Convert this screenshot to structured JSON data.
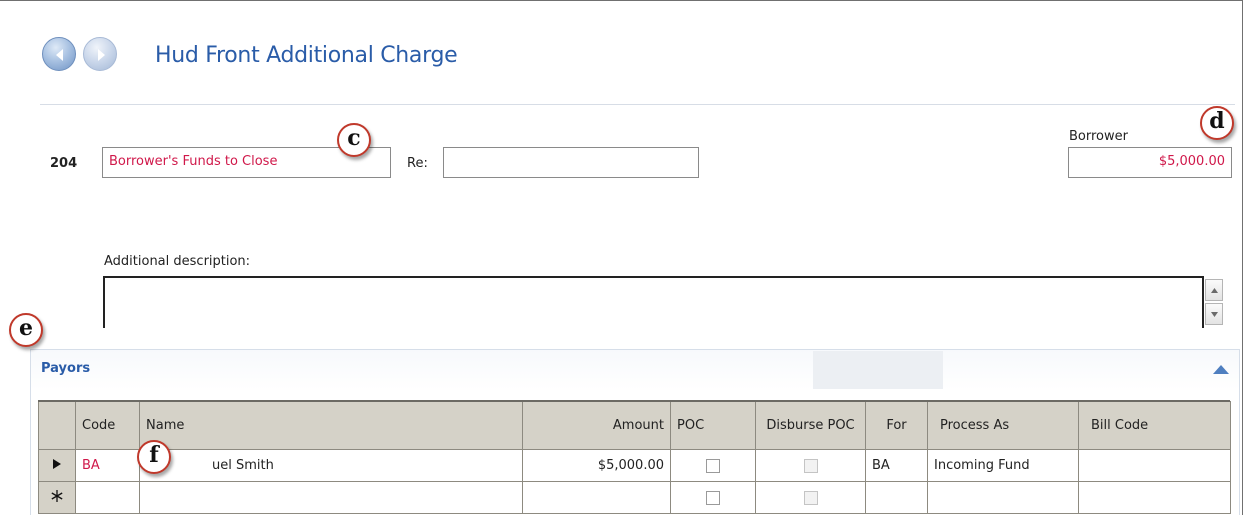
{
  "header": {
    "title": "Hud Front Additional Charge",
    "back_icon": "back-arrow-icon",
    "forward_icon": "forward-arrow-icon"
  },
  "charge": {
    "line_number": "204",
    "description": "Borrower's Funds to Close",
    "re_label": "Re:",
    "re_value": "",
    "borrower_label": "Borrower",
    "borrower_amount": "$5,000.00"
  },
  "additional": {
    "label": "Additional description:",
    "value": ""
  },
  "callouts": {
    "c": "c",
    "d": "d",
    "e": "e",
    "f": "f"
  },
  "payors": {
    "title": "Payors",
    "columns": [
      "Code",
      "Name",
      "Amount",
      "POC",
      "Disburse POC",
      "For",
      "Process As",
      "Bill Code"
    ],
    "rows": [
      {
        "code": "BA",
        "name": "uel Smith",
        "amount": "$5,000.00",
        "poc": false,
        "disburse_poc": false,
        "for": "BA",
        "process_as": "Incoming Fund",
        "bill_code": ""
      }
    ],
    "current_row_icon": "row-pointer-icon",
    "new_row_icon": "new-row-asterisk-icon"
  },
  "colors": {
    "accent": "#2a5ca8",
    "value_red": "#d0184a",
    "grid_header": "#d5d2c8"
  }
}
